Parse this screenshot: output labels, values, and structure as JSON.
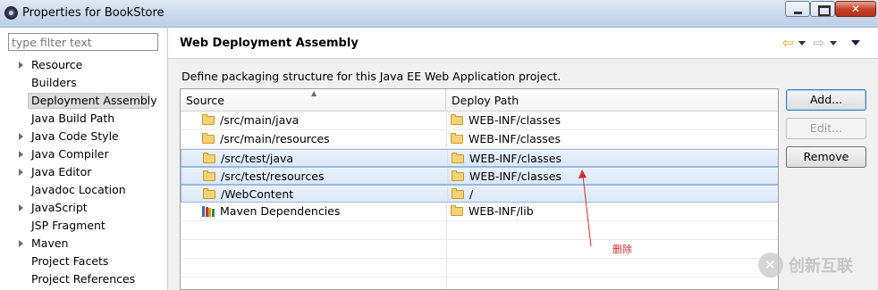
{
  "window": {
    "title": "Properties for BookStore"
  },
  "left": {
    "filter_placeholder": "type filter text",
    "items": [
      {
        "label": "Resource",
        "expandable": true
      },
      {
        "label": "Builders",
        "expandable": false
      },
      {
        "label": "Deployment Assembly",
        "expandable": false,
        "selected": true
      },
      {
        "label": "Java Build Path",
        "expandable": false
      },
      {
        "label": "Java Code Style",
        "expandable": true
      },
      {
        "label": "Java Compiler",
        "expandable": true
      },
      {
        "label": "Java Editor",
        "expandable": true
      },
      {
        "label": "Javadoc Location",
        "expandable": false
      },
      {
        "label": "JavaScript",
        "expandable": true
      },
      {
        "label": "JSP Fragment",
        "expandable": false
      },
      {
        "label": "Maven",
        "expandable": true
      },
      {
        "label": "Project Facets",
        "expandable": false
      },
      {
        "label": "Project References",
        "expandable": false
      }
    ]
  },
  "page": {
    "title": "Web Deployment Assembly",
    "description": "Define packaging structure for this Java EE Web Application project."
  },
  "table": {
    "columns": {
      "source": "Source",
      "deploy_path": "Deploy Path"
    },
    "rows": [
      {
        "source": "/src/main/java",
        "path": "WEB-INF/classes",
        "selected": false,
        "icon": "folder-icon"
      },
      {
        "source": "/src/main/resources",
        "path": "WEB-INF/classes",
        "selected": false,
        "icon": "folder-icon"
      },
      {
        "source": "/src/test/java",
        "path": "WEB-INF/classes",
        "selected": true,
        "icon": "folder-icon"
      },
      {
        "source": "/src/test/resources",
        "path": "WEB-INF/classes",
        "selected": true,
        "icon": "folder-icon"
      },
      {
        "source": "/WebContent",
        "path": "/",
        "selected": true,
        "icon": "folder-icon"
      },
      {
        "source": "Maven Dependencies",
        "path": "WEB-INF/lib",
        "selected": false,
        "icon": "library-icon"
      }
    ]
  },
  "buttons": {
    "add": "Add...",
    "edit": "Edit...",
    "remove": "Remove"
  },
  "annotation": {
    "text": "删除",
    "color": "#d32d2d"
  },
  "watermark": {
    "text": "创新互联"
  }
}
